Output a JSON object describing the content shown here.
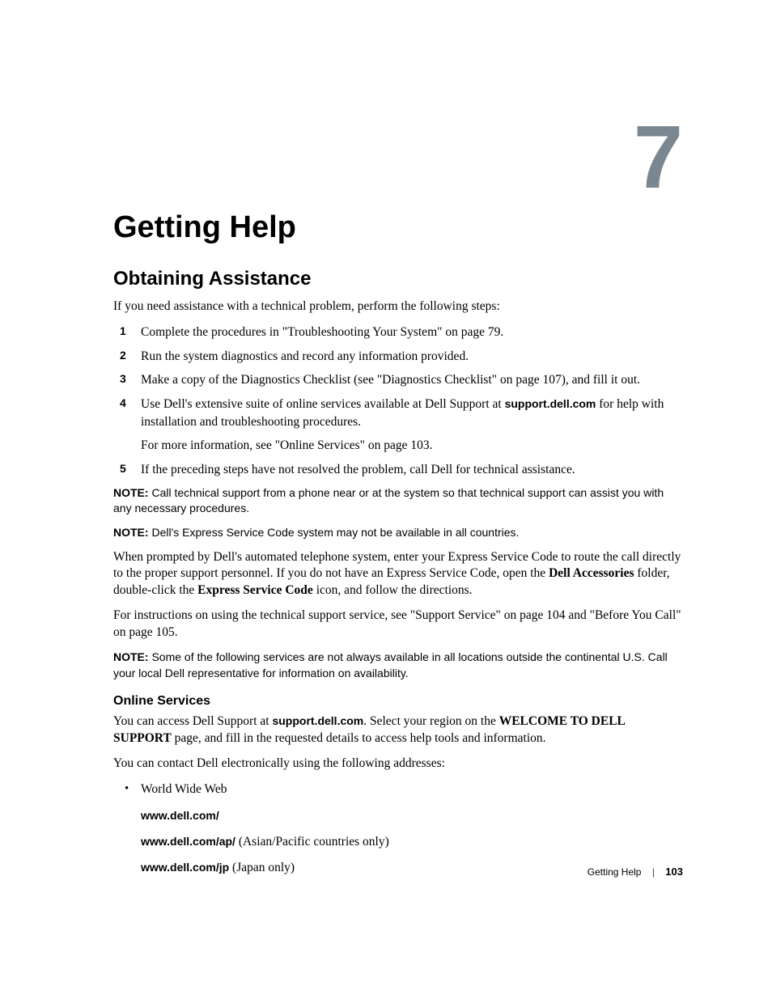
{
  "chapter_number": "7",
  "chapter_title": "Getting Help",
  "section_title": "Obtaining Assistance",
  "intro": "If you need assistance with a technical problem, perform the following steps:",
  "steps": [
    {
      "num": "1",
      "text": "Complete the procedures in \"Troubleshooting Your System\" on page 79."
    },
    {
      "num": "2",
      "text": "Run the system diagnostics and record any information provided."
    },
    {
      "num": "3",
      "text": "Make a copy of the Diagnostics Checklist (see \"Diagnostics Checklist\" on page 107), and fill it out."
    },
    {
      "num": "4",
      "pre": "Use Dell's extensive suite of online services available at Dell Support at ",
      "bold": "support.dell.com",
      "post": " for help with installation and troubleshooting procedures.",
      "sub": "For more information, see \"Online Services\" on page 103."
    },
    {
      "num": "5",
      "text": "If the preceding steps have not resolved the problem, call Dell for technical assistance."
    }
  ],
  "note_label": "NOTE:",
  "notes": {
    "n1": "Call technical support from a phone near or at the system so that technical support can assist you with any necessary procedures.",
    "n2": "Dell's Express Service Code system may not be available in all countries.",
    "n3": "Some of the following services are not always available in all locations outside the continental U.S. Call your local Dell representative for information on availability."
  },
  "esc_para": {
    "pre": "When prompted by Dell's automated telephone system, enter your Express Service Code to route the call directly to the proper support personnel. If you do not have an Express Service Code, open the ",
    "b1": "Dell Accessories",
    "mid": " folder, double-click the ",
    "b2": "Express Service Code",
    "post": " icon, and follow the directions."
  },
  "instr_para": "For instructions on using the technical support service, see \"Support Service\" on page 104 and \"Before You Call\" on page 105.",
  "online_subhead": "Online Services",
  "online_p1": {
    "pre": "You can access Dell Support at ",
    "b1": "support.dell.com",
    "mid": ". Select your region on the ",
    "b2": "WELCOME TO DELL SUPPORT",
    "post": " page, and fill in the requested details to access help tools and information."
  },
  "online_p2": "You can contact Dell electronically using the following addresses:",
  "bullet_label": "World Wide Web",
  "links": {
    "l1": "www.dell.com/",
    "l2": {
      "bold": "www.dell.com/ap/",
      "tail": " (Asian/Pacific countries only)"
    },
    "l3": {
      "bold": "www.dell.com/jp",
      "tail": " (Japan only)"
    }
  },
  "footer": {
    "section": "Getting Help",
    "page": "103"
  }
}
